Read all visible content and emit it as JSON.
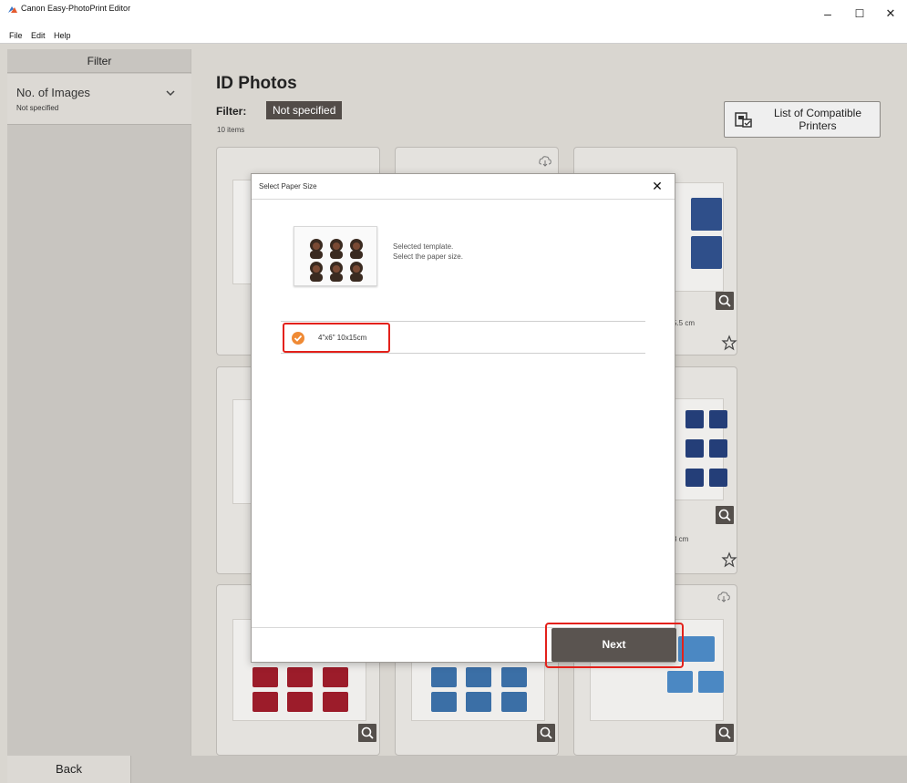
{
  "window": {
    "title": "Canon Easy-PhotoPrint Editor",
    "minimize": "–",
    "maximize": "☐",
    "close": "✕"
  },
  "menu": [
    "File",
    "Edit",
    "Help"
  ],
  "sidebar": {
    "header": "Filter",
    "filter_label": "No. of Images",
    "filter_value": "Not specified"
  },
  "main": {
    "title": "ID Photos",
    "filter_label": "Filter:",
    "filter_chip": "Not specified",
    "item_count": "10 items",
    "compat_button": "List of Compatible Printers"
  },
  "cards": {
    "c3_size": "5.5 cm",
    "c6_size": "3 cm"
  },
  "dialog": {
    "title": "Select Paper Size",
    "close": "✕",
    "template_line1": "Selected template.",
    "template_line2": "Select the paper size.",
    "option_label": "4\"x6\" 10x15cm",
    "next_button": "Next"
  },
  "bottom": {
    "back_button": "Back"
  },
  "colors": {
    "accent_red": "#e3211b",
    "radio_orange": "#ef8a35",
    "dark_button": "#5a5450"
  }
}
